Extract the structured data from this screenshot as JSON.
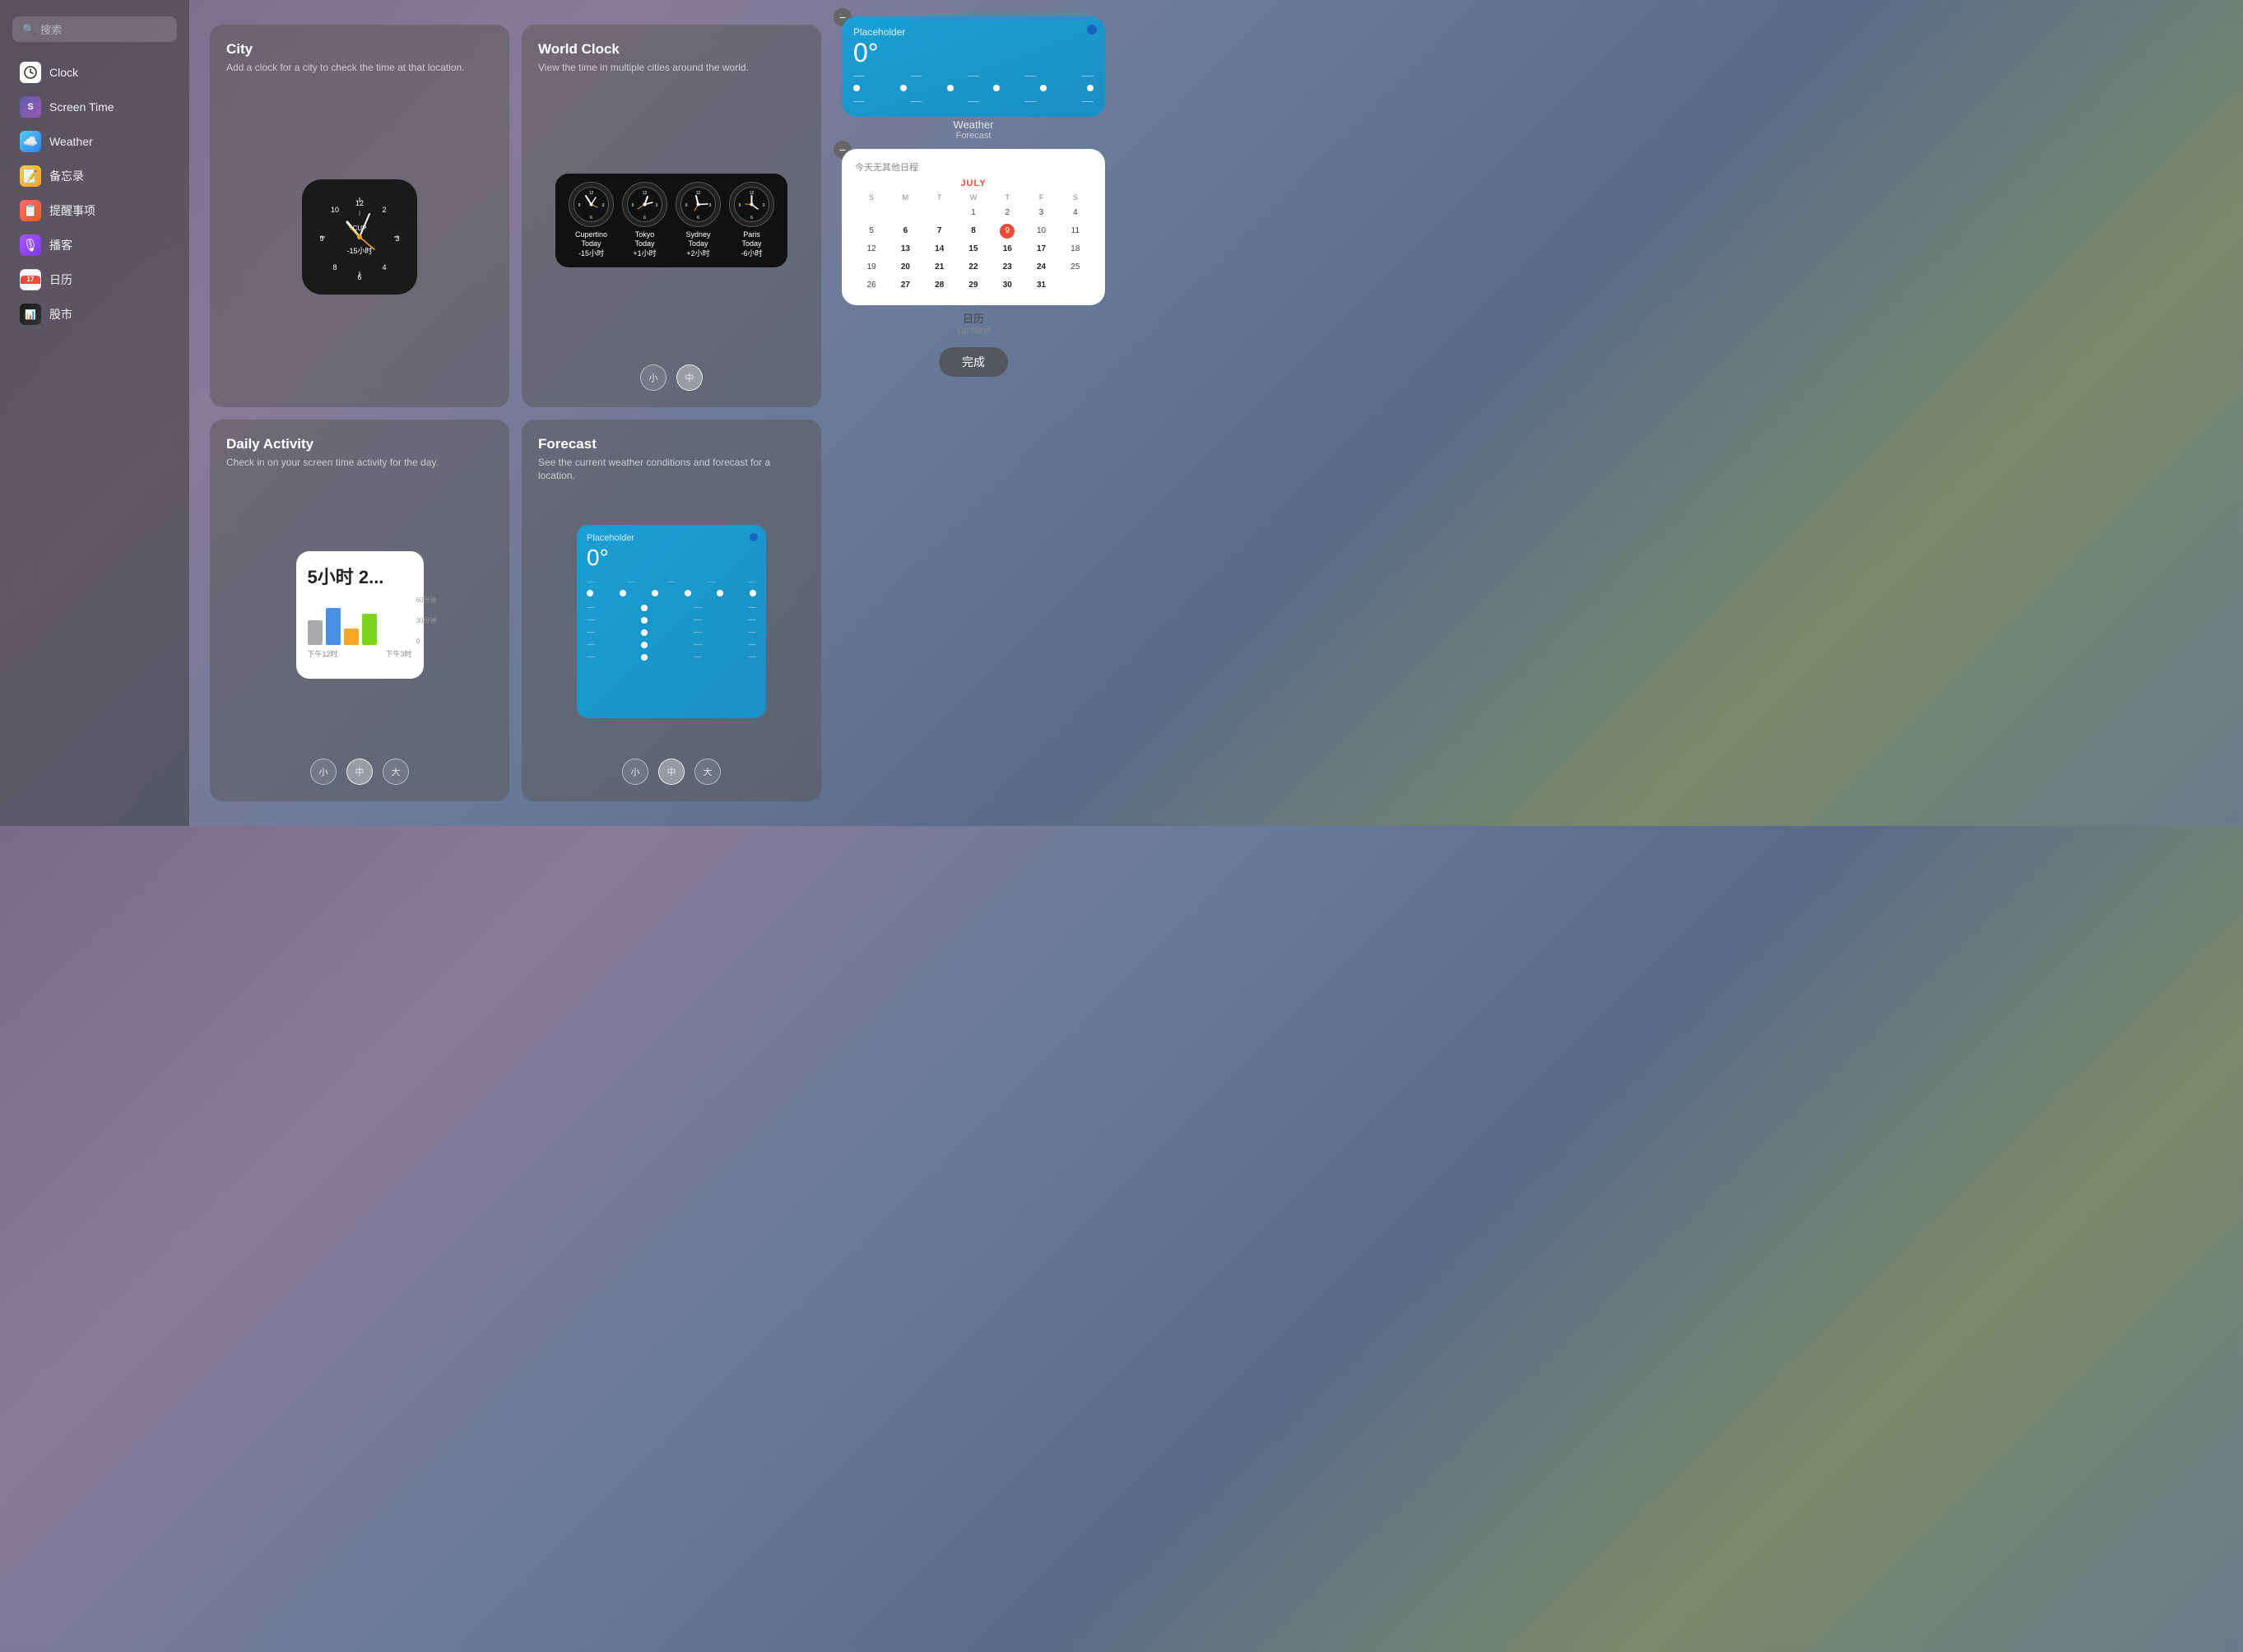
{
  "sidebar": {
    "search_placeholder": "搜索",
    "items": [
      {
        "id": "clock",
        "label": "Clock",
        "icon_class": "icon-clock",
        "icon": "🕐"
      },
      {
        "id": "screentime",
        "label": "Screen Time",
        "icon_class": "icon-screentime",
        "icon": "S"
      },
      {
        "id": "weather",
        "label": "Weather",
        "icon_class": "icon-weather",
        "icon": "🌤"
      },
      {
        "id": "notes",
        "label": "备忘录",
        "icon_class": "icon-notes",
        "icon": "📝"
      },
      {
        "id": "reminders",
        "label": "提醒事项",
        "icon_class": "icon-reminders",
        "icon": "📋"
      },
      {
        "id": "podcast",
        "label": "播客",
        "icon_class": "icon-podcast",
        "icon": "🎙"
      },
      {
        "id": "calendar",
        "label": "日历",
        "icon_class": "icon-calendar",
        "icon": "📅"
      },
      {
        "id": "stocks",
        "label": "股市",
        "icon_class": "icon-stocks",
        "icon": "📈"
      }
    ]
  },
  "main": {
    "cards": [
      {
        "id": "city",
        "title": "City",
        "desc": "Add a clock for a city to check the time at that location."
      },
      {
        "id": "world-clock",
        "title": "World Clock",
        "desc": "View the time in multiple cities around the world.",
        "size_buttons": [
          "小",
          "中"
        ],
        "selected_size": "中"
      },
      {
        "id": "daily-activity",
        "title": "Daily Activity",
        "desc": "Check in on your screen time activity for the day.",
        "size_buttons": [
          "小",
          "中",
          "大"
        ],
        "selected_size": "中"
      },
      {
        "id": "forecast",
        "title": "Forecast",
        "desc": "See the current weather conditions and forecast for a location.",
        "size_buttons": [
          "小",
          "中",
          "大"
        ],
        "selected_size": "中"
      }
    ],
    "world_clock_cities": [
      {
        "name": "Cupertino",
        "sub": "Today",
        "time_offset": "-15小时"
      },
      {
        "name": "Tokyo",
        "sub": "Today",
        "time_offset": "+1小时"
      },
      {
        "name": "Sydney",
        "sub": "Today",
        "time_offset": "+2小时"
      },
      {
        "name": "Paris",
        "sub": "Today",
        "time_offset": "-6小时"
      }
    ],
    "activity_widget": {
      "time_text": "5小时 2...",
      "chart_label1": "下午12时",
      "chart_label2": "下午3时",
      "y_label1": "60分钟",
      "y_label2": "30分钟",
      "y_label3": "0"
    },
    "forecast_widget_small": {
      "placeholder": "Placeholder",
      "temp": "0°"
    },
    "forecast_widget_large": {
      "placeholder": "Placeholder",
      "temp": "0°"
    }
  },
  "right_panel": {
    "weather_card": {
      "placeholder": "Placeholder",
      "temp": "0°",
      "label": "Weather",
      "sublabel": "Forecast"
    },
    "calendar_card": {
      "no_events": "今天无其他日程",
      "month": "JULY",
      "day_headers": [
        "S",
        "M",
        "T",
        "W",
        "T",
        "F",
        "S"
      ],
      "weeks": [
        [
          "",
          "",
          "",
          "1",
          "2",
          "3",
          "4"
        ],
        [
          "5",
          "6",
          "7",
          "8",
          "9",
          "10",
          "11"
        ],
        [
          "12",
          "13",
          "14",
          "15",
          "16",
          "17",
          "18"
        ],
        [
          "19",
          "20",
          "21",
          "22",
          "23",
          "24",
          "25"
        ],
        [
          "26",
          "27",
          "28",
          "29",
          "30",
          "31",
          ""
        ]
      ],
      "today": "9",
      "label": "日历",
      "sublabel": "Up Next"
    },
    "done_button": "完成"
  }
}
